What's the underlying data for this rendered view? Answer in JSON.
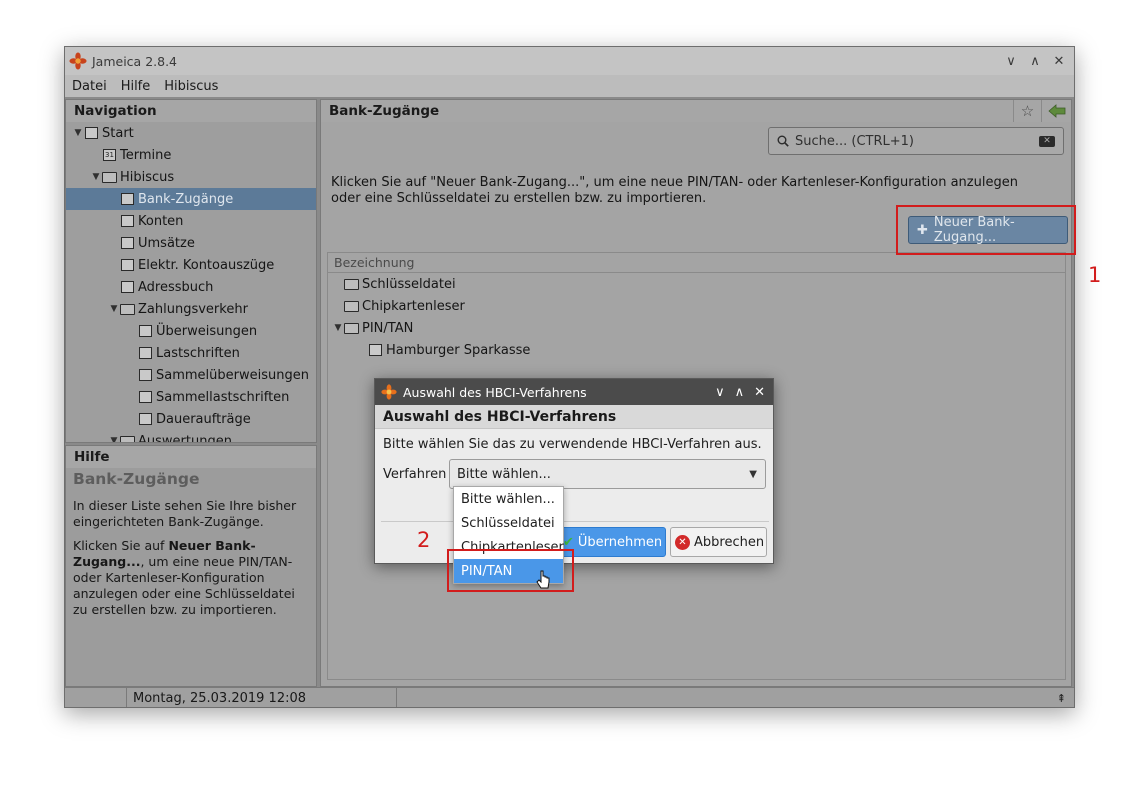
{
  "window": {
    "title": "Jameica 2.8.4",
    "controls": [
      "∨",
      "∧",
      "✕"
    ]
  },
  "menubar": [
    "Datei",
    "Hilfe",
    "Hibiscus"
  ],
  "navigation": {
    "header": "Navigation",
    "items": [
      {
        "label": "Start",
        "arrow": "▼",
        "icon": "monitor-icon"
      },
      {
        "label": "Termine",
        "arrow": "",
        "icon": "calendar-icon",
        "icon_text": "31"
      },
      {
        "label": "Hibiscus",
        "arrow": "▼",
        "icon": "folder-icon"
      },
      {
        "label": "Bank-Zugänge",
        "arrow": "",
        "icon": "bank-users-icon",
        "selected": true
      },
      {
        "label": "Konten",
        "arrow": "",
        "icon": "accounts-icon"
      },
      {
        "label": "Umsätze",
        "arrow": "",
        "icon": "transactions-icon"
      },
      {
        "label": "Elektr. Kontoauszüge",
        "arrow": "",
        "icon": "statement-icon"
      },
      {
        "label": "Adressbuch",
        "arrow": "",
        "icon": "addressbook-icon"
      },
      {
        "label": "Zahlungsverkehr",
        "arrow": "▼",
        "icon": "folder-icon"
      },
      {
        "label": "Überweisungen",
        "arrow": "",
        "icon": "transfer-icon"
      },
      {
        "label": "Lastschriften",
        "arrow": "",
        "icon": "debit-icon"
      },
      {
        "label": "Sammelüberweisungen",
        "arrow": "",
        "icon": "batch-transfer-icon"
      },
      {
        "label": "Sammellastschriften",
        "arrow": "",
        "icon": "batch-debit-icon"
      },
      {
        "label": "Daueraufträge",
        "arrow": "",
        "icon": "standing-order-icon"
      },
      {
        "label": "Auswertungen",
        "arrow": "▼",
        "icon": "folder-icon"
      }
    ]
  },
  "help": {
    "header": "Hilfe",
    "title": "Bank-Zugänge",
    "para1": "In dieser Liste sehen Sie Ihre bisher eingerichteten Bank-Zugänge.",
    "para2_pre": "Klicken Sie auf ",
    "para2_bold": "Neuer Bank-Zugang...",
    "para2_post": ", um eine neue PIN/TAN- oder Kartenleser-Konfiguration anzulegen oder eine Schlüsseldatei zu erstellen bzw. zu importieren."
  },
  "content": {
    "header": "Bank-Zugänge",
    "search_placeholder": "Suche...  (CTRL+1)",
    "info": "Klicken Sie auf \"Neuer Bank-Zugang...\", um eine neue PIN/TAN- oder Kartenleser-Konfiguration anzulegen oder eine Schlüsseldatei zu erstellen bzw. zu importieren.",
    "new_button": "Neuer Bank-Zugang...",
    "list_header": "Bezeichnung",
    "rows": [
      {
        "label": "Schlüsseldatei",
        "arrow": "",
        "indent": 0
      },
      {
        "label": "Chipkartenleser",
        "arrow": "",
        "indent": 0
      },
      {
        "label": "PIN/TAN",
        "arrow": "▼",
        "indent": 0
      },
      {
        "label": "Hamburger Sparkasse",
        "arrow": "",
        "indent": 1
      }
    ]
  },
  "statusbar": {
    "text": "Montag, 25.03.2019 12:08",
    "expand": "⇞"
  },
  "dialog": {
    "title": "Auswahl des HBCI-Verfahrens",
    "heading": "Auswahl des HBCI-Verfahrens",
    "instruction": "Bitte wählen Sie das zu verwendende HBCI-Verfahren aus.",
    "field_label": "Verfahren",
    "select_value": "Bitte wählen...",
    "ok_button": "Übernehmen",
    "cancel_button": "Abbrechen",
    "options": [
      "Bitte wählen...",
      "Schlüsseldatei",
      "Chipkartenleser",
      "PIN/TAN"
    ],
    "highlighted_option": "PIN/TAN"
  },
  "annotations": {
    "marker1": "1",
    "marker2": "2",
    "color": "#d21c1c"
  }
}
